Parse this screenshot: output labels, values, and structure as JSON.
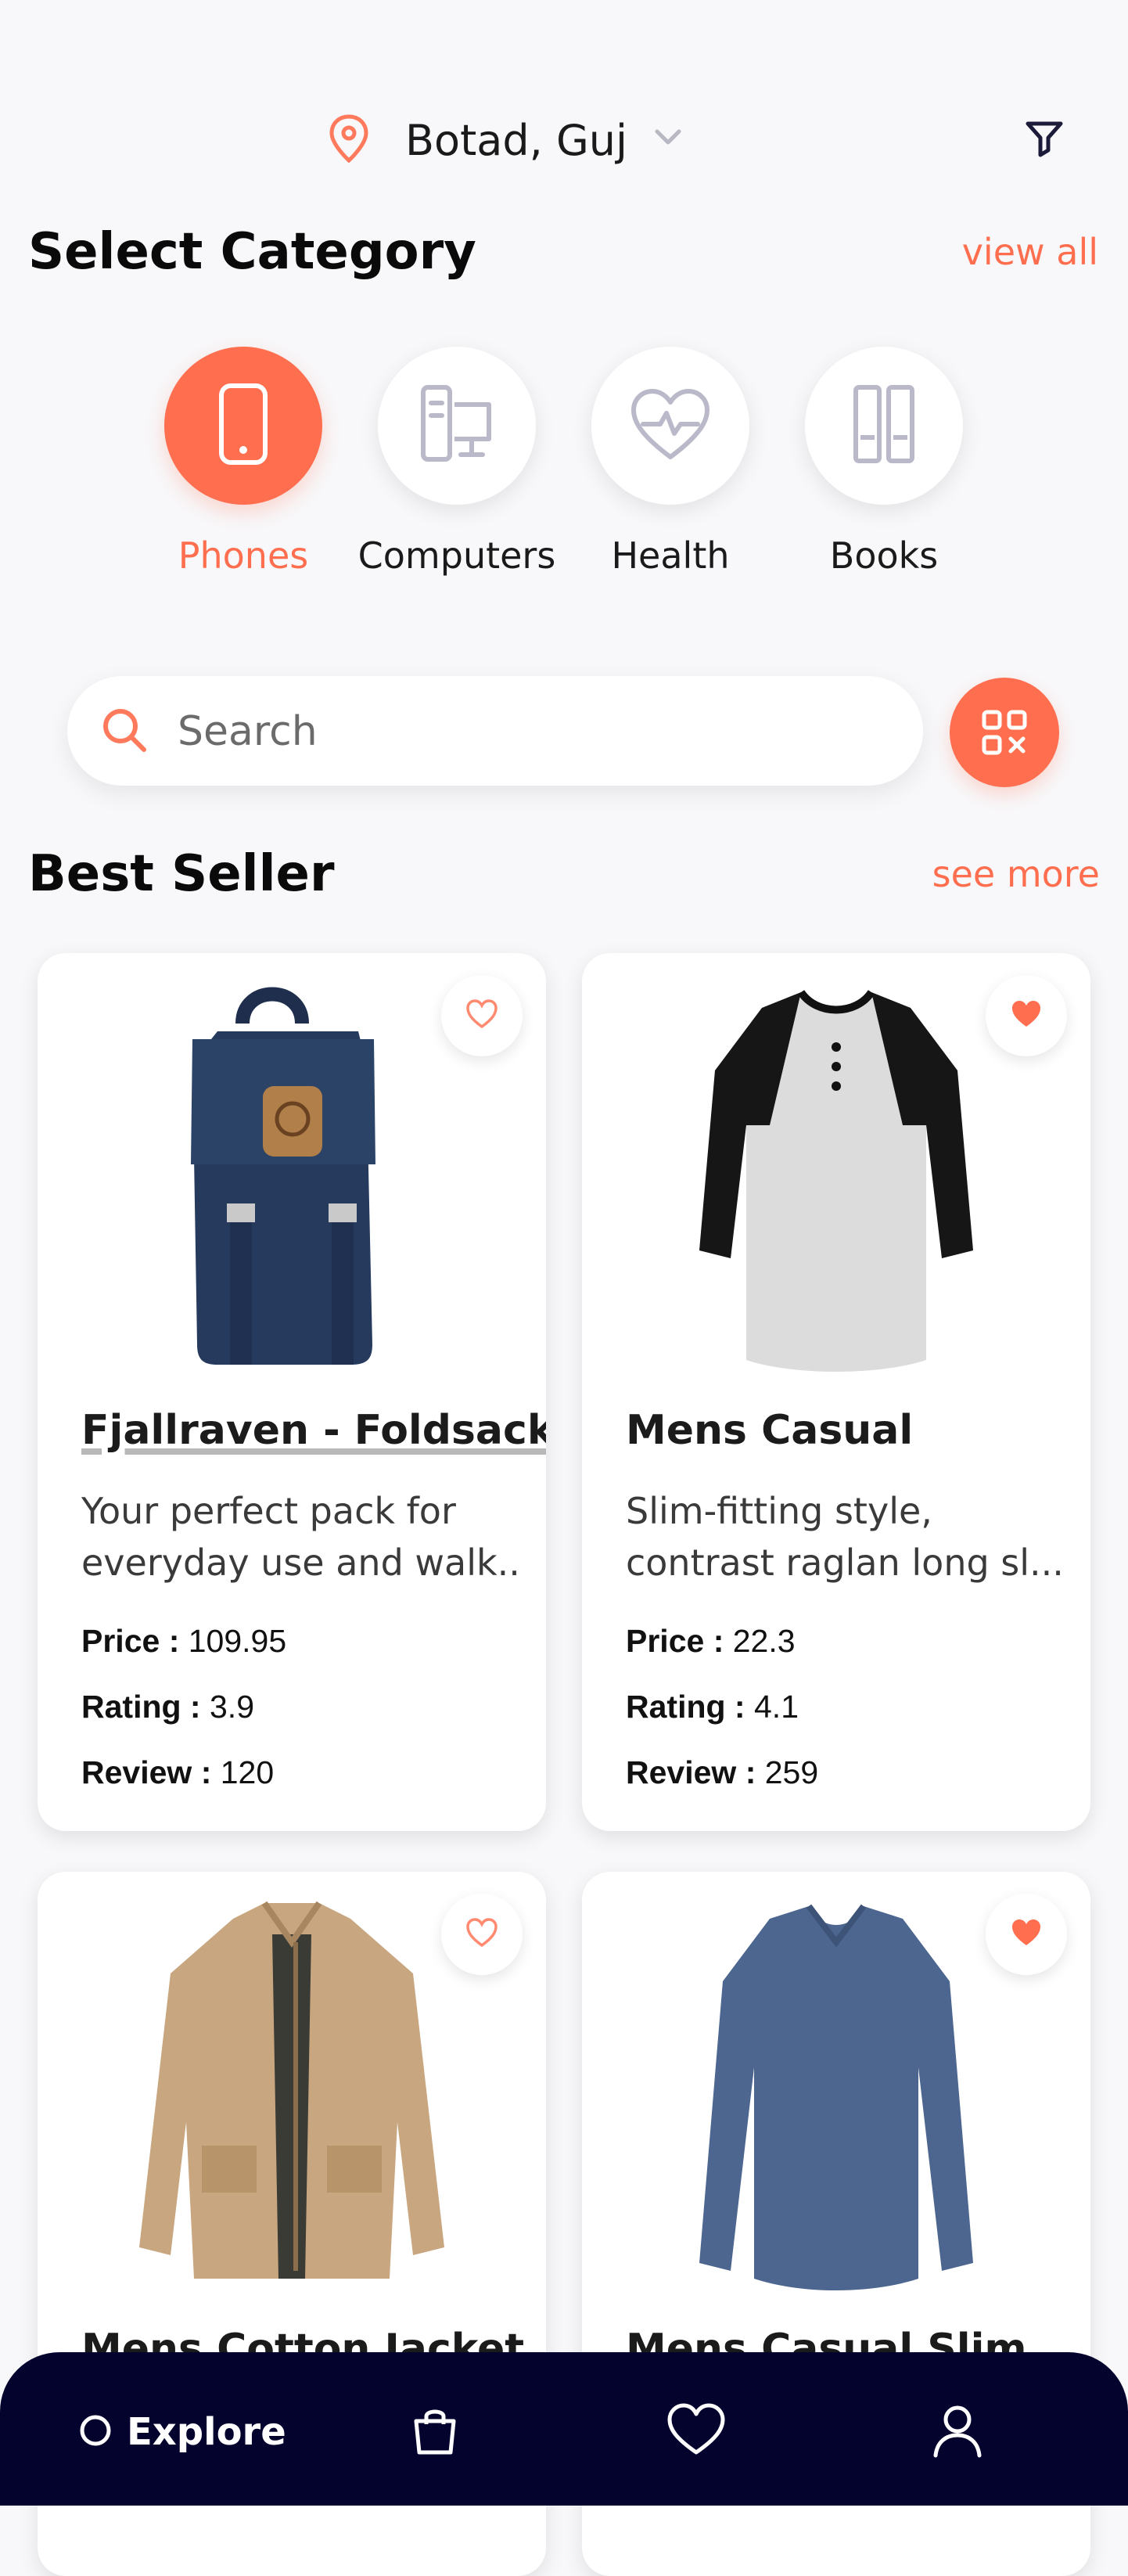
{
  "header": {
    "location": "Botad, Guj",
    "icons": [
      "map-pin-icon",
      "chevron-down-icon",
      "filter-icon"
    ]
  },
  "categories": {
    "title": "Select Category",
    "view_all": "view all",
    "items": [
      {
        "label": "Phones",
        "icon": "phone-icon",
        "active": true
      },
      {
        "label": "Computers",
        "icon": "computer-icon",
        "active": false
      },
      {
        "label": "Health",
        "icon": "heart-pulse-icon",
        "active": false
      },
      {
        "label": "Books",
        "icon": "books-icon",
        "active": false
      }
    ]
  },
  "search": {
    "placeholder": "Search",
    "value": "",
    "icons": [
      "search-icon",
      "qr-scan-icon"
    ]
  },
  "best_seller": {
    "title": "Best Seller",
    "see_more": "see more",
    "price_label": "Price :",
    "rating_label": "Rating :",
    "review_label": "Review :",
    "products": [
      {
        "name": "Fjallraven - Foldsack",
        "desc_line1": "Your perfect pack for",
        "desc_line2": "everyday use and walk...",
        "price": "109.95",
        "rating": "3.9",
        "review": "120",
        "favorited": false,
        "image": "backpack"
      },
      {
        "name": "Mens Casual",
        "desc_line1": "Slim-fitting style,",
        "desc_line2": "contrast raglan long sl...",
        "price": "22.3",
        "rating": "4.1",
        "review": "259",
        "favorited": true,
        "image": "raglan-tshirt"
      },
      {
        "name": "Mens Cotton Jacket",
        "favorited": false,
        "image": "cotton-jacket"
      },
      {
        "name": "Mens Casual Slim",
        "favorited": true,
        "image": "long-sleeve-tshirt"
      }
    ]
  },
  "bottom_nav": {
    "explore_label": "Explore",
    "items": [
      "explore",
      "bag-icon",
      "heart-icon",
      "profile-icon"
    ]
  },
  "colors": {
    "accent": "#ff6e4e",
    "background": "#f8f8fa",
    "nav_background": "#04032e",
    "inactive_icon": "#b9b9c9"
  }
}
